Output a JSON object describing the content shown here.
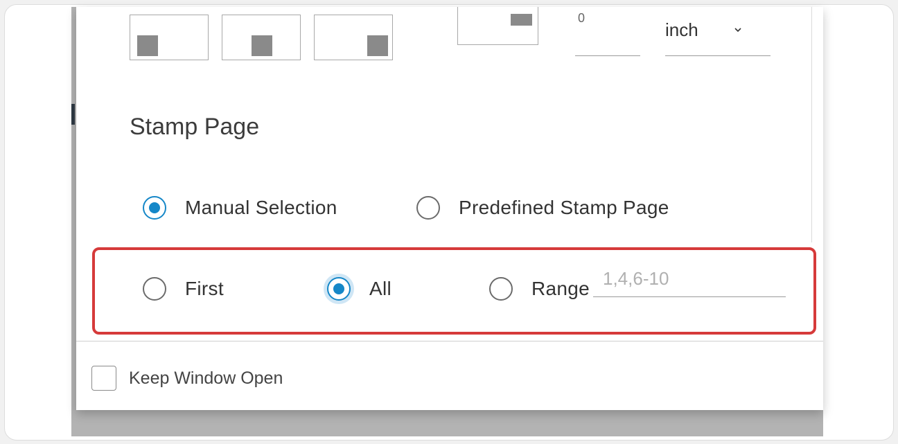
{
  "position_grid": {
    "boxes": [
      {
        "name": "bottom-left"
      },
      {
        "name": "bottom-center"
      },
      {
        "name": "bottom-right"
      }
    ]
  },
  "offset": {
    "value": "0",
    "unit": "inch"
  },
  "stamp_page": {
    "title": "Stamp Page",
    "mode_options": [
      {
        "label": "Manual Selection",
        "selected": true
      },
      {
        "label": "Predefined Stamp Page",
        "selected": false
      }
    ],
    "page_options": [
      {
        "label": "First",
        "selected": false
      },
      {
        "label": "All",
        "selected": true
      },
      {
        "label": "Range",
        "selected": false
      }
    ],
    "range_placeholder": "1,4,6-10"
  },
  "footer": {
    "keep_window_open_label": "Keep Window Open",
    "keep_window_open_checked": false
  },
  "colors": {
    "accent": "#1587c8",
    "highlight_border": "#d63a3a"
  }
}
